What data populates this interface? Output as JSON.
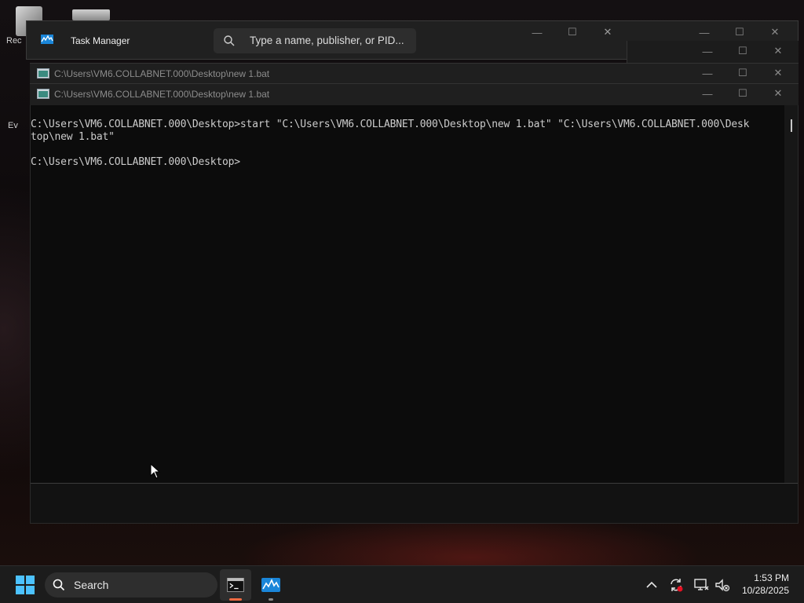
{
  "desktop": {
    "icons": [
      {
        "label": "Rec"
      },
      {
        "label": "Ev"
      }
    ]
  },
  "task_manager": {
    "title": "Task Manager",
    "search_placeholder": "Type a name, publisher, or PID...",
    "buttons": {
      "minimize": "—",
      "maximize": "☐",
      "close": "✕"
    }
  },
  "console_windows": [
    {
      "title": "C:\\Users\\VM6.COLLABNET.000\\Desktop\\new 1.bat"
    },
    {
      "title": "C:\\Users\\VM6.COLLABNET.000\\Desktop\\new 1.bat"
    }
  ],
  "console": {
    "lines": [
      "C:\\Users\\VM6.COLLABNET.000\\Desktop>start \"C:\\Users\\VM6.COLLABNET.000\\Desktop\\new 1.bat\" \"C:\\Users\\VM6.COLLABNET.000\\Desk",
      "top\\new 1.bat\"",
      "",
      "C:\\Users\\VM6.COLLABNET.000\\Desktop>"
    ]
  },
  "taskbar": {
    "search_label": "Search",
    "apps": [
      {
        "name": "terminal",
        "active": true
      },
      {
        "name": "task-manager",
        "active": false
      }
    ],
    "clock": {
      "time": "1:53 PM",
      "date": "10/28/2025"
    }
  },
  "colors": {
    "accent": "#f06a42",
    "console_bg": "#0c0c0c",
    "titlebar_bg": "#202020",
    "taskbar_bg": "#1c1c1c"
  }
}
